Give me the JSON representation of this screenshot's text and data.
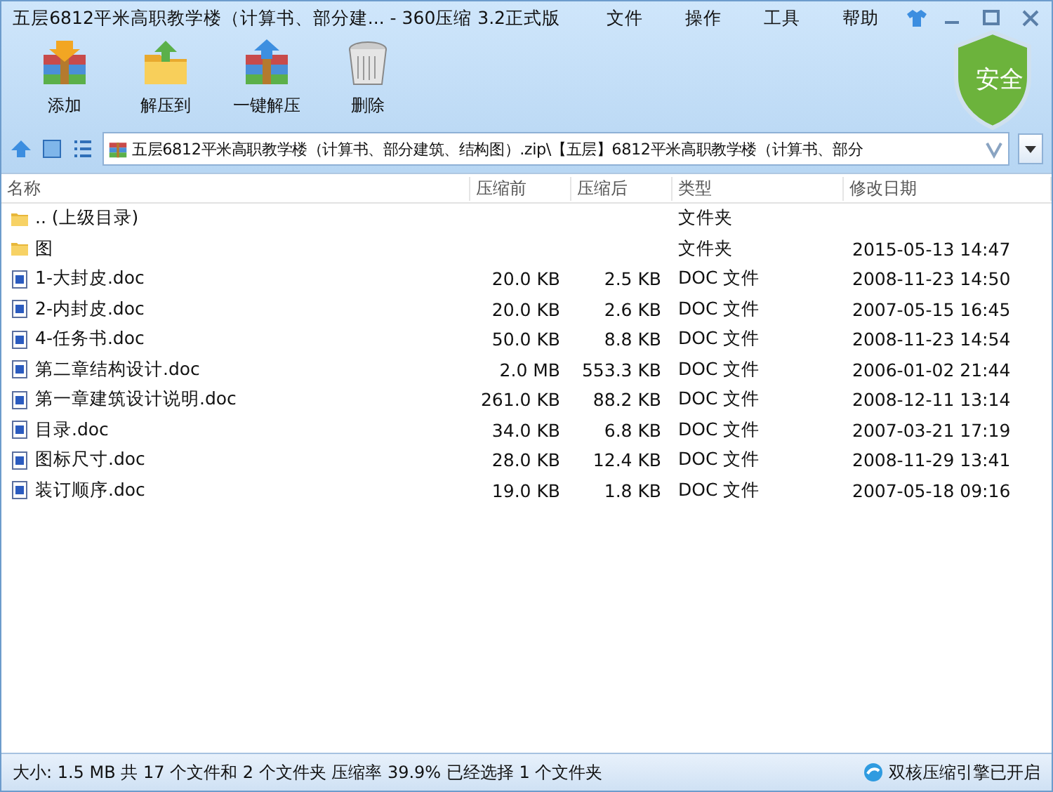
{
  "window": {
    "title": "五层6812平米高职教学楼（计算书、部分建... - 360压缩 3.2正式版"
  },
  "menu": [
    "文件",
    "操作",
    "工具",
    "帮助"
  ],
  "toolbar": [
    "添加",
    "解压到",
    "一键解压",
    "删除"
  ],
  "security_badge": "安全",
  "address_bar": {
    "path": "五层6812平米高职教学楼（计算书、部分建筑、结构图）.zip\\【五层】6812平米高职教学楼（计算书、部分"
  },
  "table": {
    "columns": [
      "名称",
      "压缩前",
      "压缩后",
      "类型",
      "修改日期"
    ],
    "rows": [
      {
        "kind": "folder",
        "name": ".. (上级目录)",
        "size": "",
        "packed": "",
        "type": "文件夹",
        "modified": ""
      },
      {
        "kind": "folder",
        "name": "图",
        "size": "",
        "packed": "",
        "type": "文件夹",
        "modified": "2015-05-13 14:47"
      },
      {
        "kind": "doc",
        "name": "1-大封皮.doc",
        "size": "20.0 KB",
        "packed": "2.5 KB",
        "type": "DOC 文件",
        "modified": "2008-11-23 14:50"
      },
      {
        "kind": "doc",
        "name": "2-内封皮.doc",
        "size": "20.0 KB",
        "packed": "2.6 KB",
        "type": "DOC 文件",
        "modified": "2007-05-15 16:45"
      },
      {
        "kind": "doc",
        "name": "4-任务书.doc",
        "size": "50.0 KB",
        "packed": "8.8 KB",
        "type": "DOC 文件",
        "modified": "2008-11-23 14:54"
      },
      {
        "kind": "doc",
        "name": "第二章结构设计.doc",
        "size": "2.0 MB",
        "packed": "553.3 KB",
        "type": "DOC 文件",
        "modified": "2006-01-02 21:44"
      },
      {
        "kind": "doc",
        "name": "第一章建筑设计说明.doc",
        "size": "261.0 KB",
        "packed": "88.2 KB",
        "type": "DOC 文件",
        "modified": "2008-12-11 13:14"
      },
      {
        "kind": "doc",
        "name": "目录.doc",
        "size": "34.0 KB",
        "packed": "6.8 KB",
        "type": "DOC 文件",
        "modified": "2007-03-21 17:19"
      },
      {
        "kind": "doc",
        "name": "图标尺寸.doc",
        "size": "28.0 KB",
        "packed": "12.4 KB",
        "type": "DOC 文件",
        "modified": "2008-11-29 13:41"
      },
      {
        "kind": "doc",
        "name": "装订顺序.doc",
        "size": "19.0 KB",
        "packed": "1.8 KB",
        "type": "DOC 文件",
        "modified": "2007-05-18 09:16"
      }
    ]
  },
  "status_bar": {
    "summary": "大小: 1.5 MB 共 17 个文件和 2 个文件夹 压缩率 39.9% 已经选择 1 个文件夹",
    "engine": "双核压缩引擎已开启"
  }
}
